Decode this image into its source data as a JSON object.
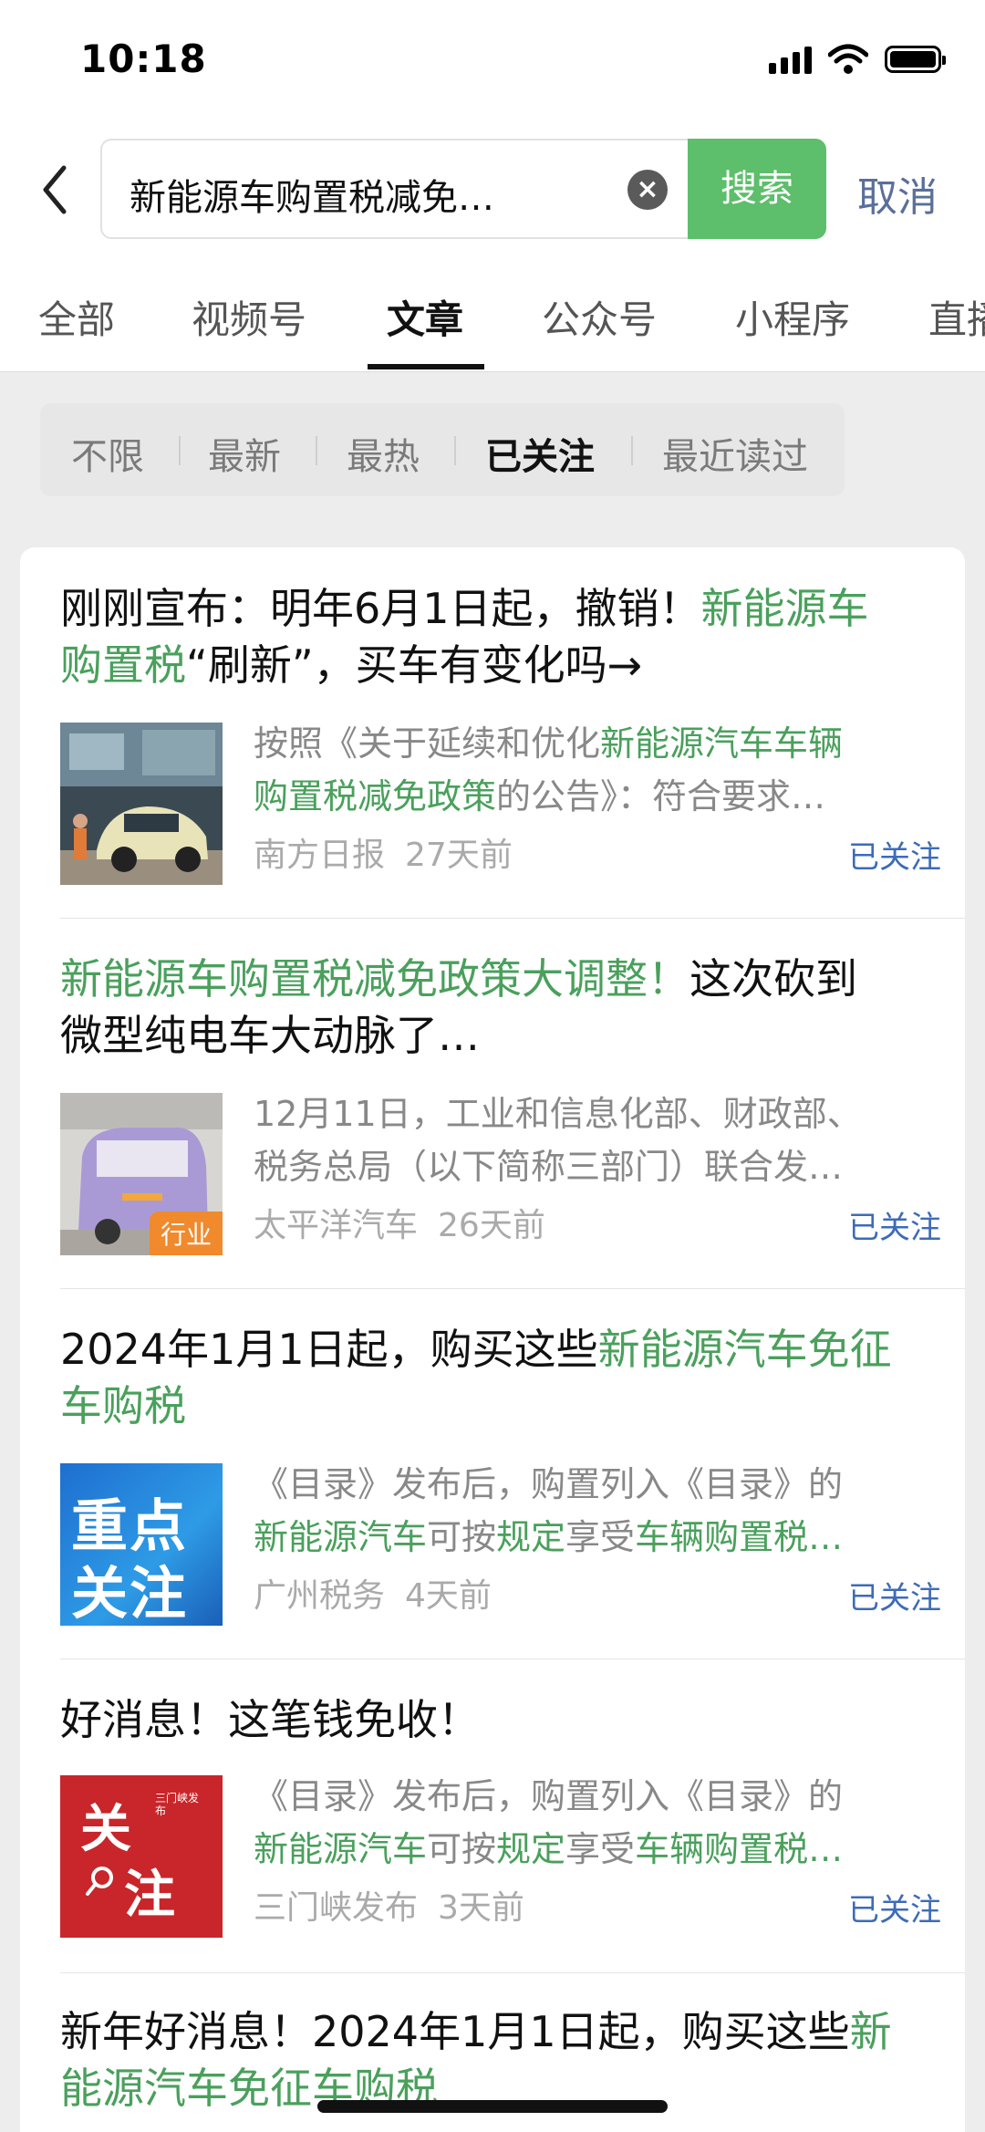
{
  "status_bar": {
    "time": "10:18"
  },
  "search": {
    "query": "新能源车购置税减免…",
    "button": "搜索",
    "cancel": "取消"
  },
  "tabs": [
    "全部",
    "视频号",
    "文章",
    "公众号",
    "小程序",
    "直播"
  ],
  "active_tab": "文章",
  "filters": [
    "不限",
    "最新",
    "最热",
    "已关注",
    "最近读过"
  ],
  "active_filter": "已关注",
  "results": [
    {
      "title_parts": [
        {
          "text": "刚刚宣布：明年6月1日起，撤销！",
          "hl": false
        },
        {
          "text": "新能源车购置税",
          "hl": true
        },
        {
          "text": "“刷新”，买车有变化吗→",
          "hl": false
        }
      ],
      "title_lines": [
        [
          {
            "text": "刚刚宣布：明年6月1日起，撤销！",
            "hl": false
          },
          {
            "text": "新能源车",
            "hl": true
          }
        ],
        [
          {
            "text": "购置税",
            "hl": true
          },
          {
            "text": "“刷新”，买车有变化吗→",
            "hl": false
          }
        ]
      ],
      "snippet_lines": [
        [
          {
            "text": "按照《关于延续和优化",
            "hl": false
          },
          {
            "text": "新能源汽车车辆",
            "hl": true
          }
        ],
        [
          {
            "text": "购置税减免政策",
            "hl": true
          },
          {
            "text": "的公告》：符合要求…",
            "hl": false
          }
        ]
      ],
      "source": "南方日报",
      "time": "27天前",
      "follow_label": "已关注",
      "thumb": "car-photo"
    },
    {
      "title_lines": [
        [
          {
            "text": "新能源车购置税减免政策大调整！",
            "hl": true
          },
          {
            "text": "这次砍到",
            "hl": false
          }
        ],
        [
          {
            "text": "微型纯电车大动脉了…",
            "hl": false
          }
        ]
      ],
      "snippet_lines": [
        [
          {
            "text": "12月11日，工业和信息化部、财政部、",
            "hl": false
          }
        ],
        [
          {
            "text": "税务总局（以下简称三部门）联合发…",
            "hl": false
          }
        ]
      ],
      "source": "太平洋汽车",
      "time": "26天前",
      "follow_label": "已关注",
      "thumb_badge": "行业"
    },
    {
      "title_lines": [
        [
          {
            "text": "2024年1月1日起，购买这些",
            "hl": false
          },
          {
            "text": "新能源汽车免征",
            "hl": true
          }
        ],
        [
          {
            "text": "车购税",
            "hl": true
          }
        ]
      ],
      "snippet_lines": [
        [
          {
            "text": "《目录》发布后，购置列入《目录》的",
            "hl": false
          }
        ],
        [
          {
            "text": "新能源汽车",
            "hl": true
          },
          {
            "text": "可按",
            "hl": false
          },
          {
            "text": "规定",
            "hl": true
          },
          {
            "text": "享受",
            "hl": false
          },
          {
            "text": "车辆购置税…",
            "hl": true
          }
        ]
      ],
      "source": "广州税务",
      "time": "4天前",
      "follow_label": "已关注",
      "thumb_text": [
        "重点",
        "关注"
      ]
    },
    {
      "title_lines": [
        [
          {
            "text": "好消息！这笔钱免收！",
            "hl": false
          }
        ]
      ],
      "snippet_lines": [
        [
          {
            "text": "《目录》发布后，购置列入《目录》的",
            "hl": false
          }
        ],
        [
          {
            "text": "新能源汽车",
            "hl": true
          },
          {
            "text": "可按",
            "hl": false
          },
          {
            "text": "规定",
            "hl": true
          },
          {
            "text": "享受",
            "hl": false
          },
          {
            "text": "车辆购置税…",
            "hl": true
          }
        ]
      ],
      "source": "三门峡发布",
      "time": "3天前",
      "follow_label": "已关注",
      "thumb_text": [
        "关",
        "注"
      ],
      "thumb_small": "三门峡发布"
    },
    {
      "title_lines": [
        [
          {
            "text": "新年好消息！2024年1月1日起，购买这些",
            "hl": false
          },
          {
            "text": "新",
            "hl": true
          }
        ],
        [
          {
            "text": "能源汽车免征车购税",
            "hl": true
          }
        ]
      ]
    }
  ],
  "colors": {
    "highlight": "#4aa05c",
    "search_button": "#5dbe6b",
    "link": "#3d6bb8"
  }
}
